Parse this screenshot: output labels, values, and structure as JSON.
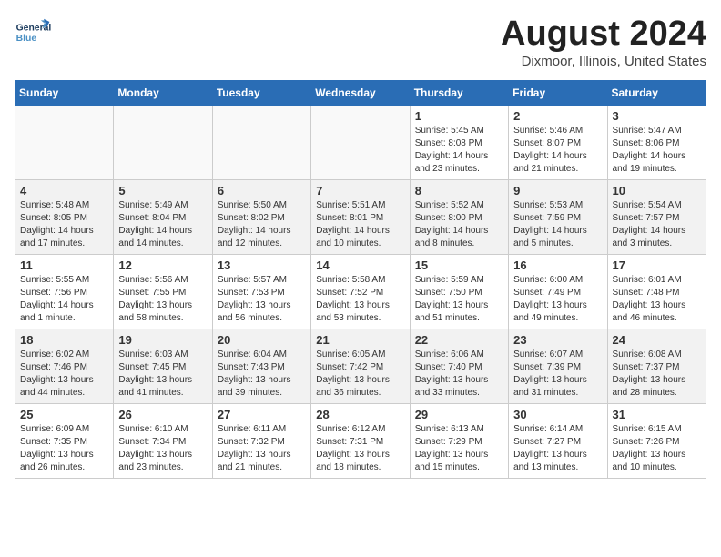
{
  "header": {
    "logo_general": "General",
    "logo_blue": "Blue",
    "title": "August 2024",
    "subtitle": "Dixmoor, Illinois, United States"
  },
  "days_of_week": [
    "Sunday",
    "Monday",
    "Tuesday",
    "Wednesday",
    "Thursday",
    "Friday",
    "Saturday"
  ],
  "weeks": [
    [
      {
        "day": "",
        "info": ""
      },
      {
        "day": "",
        "info": ""
      },
      {
        "day": "",
        "info": ""
      },
      {
        "day": "",
        "info": ""
      },
      {
        "day": "1",
        "info": "Sunrise: 5:45 AM\nSunset: 8:08 PM\nDaylight: 14 hours\nand 23 minutes."
      },
      {
        "day": "2",
        "info": "Sunrise: 5:46 AM\nSunset: 8:07 PM\nDaylight: 14 hours\nand 21 minutes."
      },
      {
        "day": "3",
        "info": "Sunrise: 5:47 AM\nSunset: 8:06 PM\nDaylight: 14 hours\nand 19 minutes."
      }
    ],
    [
      {
        "day": "4",
        "info": "Sunrise: 5:48 AM\nSunset: 8:05 PM\nDaylight: 14 hours\nand 17 minutes."
      },
      {
        "day": "5",
        "info": "Sunrise: 5:49 AM\nSunset: 8:04 PM\nDaylight: 14 hours\nand 14 minutes."
      },
      {
        "day": "6",
        "info": "Sunrise: 5:50 AM\nSunset: 8:02 PM\nDaylight: 14 hours\nand 12 minutes."
      },
      {
        "day": "7",
        "info": "Sunrise: 5:51 AM\nSunset: 8:01 PM\nDaylight: 14 hours\nand 10 minutes."
      },
      {
        "day": "8",
        "info": "Sunrise: 5:52 AM\nSunset: 8:00 PM\nDaylight: 14 hours\nand 8 minutes."
      },
      {
        "day": "9",
        "info": "Sunrise: 5:53 AM\nSunset: 7:59 PM\nDaylight: 14 hours\nand 5 minutes."
      },
      {
        "day": "10",
        "info": "Sunrise: 5:54 AM\nSunset: 7:57 PM\nDaylight: 14 hours\nand 3 minutes."
      }
    ],
    [
      {
        "day": "11",
        "info": "Sunrise: 5:55 AM\nSunset: 7:56 PM\nDaylight: 14 hours\nand 1 minute."
      },
      {
        "day": "12",
        "info": "Sunrise: 5:56 AM\nSunset: 7:55 PM\nDaylight: 13 hours\nand 58 minutes."
      },
      {
        "day": "13",
        "info": "Sunrise: 5:57 AM\nSunset: 7:53 PM\nDaylight: 13 hours\nand 56 minutes."
      },
      {
        "day": "14",
        "info": "Sunrise: 5:58 AM\nSunset: 7:52 PM\nDaylight: 13 hours\nand 53 minutes."
      },
      {
        "day": "15",
        "info": "Sunrise: 5:59 AM\nSunset: 7:50 PM\nDaylight: 13 hours\nand 51 minutes."
      },
      {
        "day": "16",
        "info": "Sunrise: 6:00 AM\nSunset: 7:49 PM\nDaylight: 13 hours\nand 49 minutes."
      },
      {
        "day": "17",
        "info": "Sunrise: 6:01 AM\nSunset: 7:48 PM\nDaylight: 13 hours\nand 46 minutes."
      }
    ],
    [
      {
        "day": "18",
        "info": "Sunrise: 6:02 AM\nSunset: 7:46 PM\nDaylight: 13 hours\nand 44 minutes."
      },
      {
        "day": "19",
        "info": "Sunrise: 6:03 AM\nSunset: 7:45 PM\nDaylight: 13 hours\nand 41 minutes."
      },
      {
        "day": "20",
        "info": "Sunrise: 6:04 AM\nSunset: 7:43 PM\nDaylight: 13 hours\nand 39 minutes."
      },
      {
        "day": "21",
        "info": "Sunrise: 6:05 AM\nSunset: 7:42 PM\nDaylight: 13 hours\nand 36 minutes."
      },
      {
        "day": "22",
        "info": "Sunrise: 6:06 AM\nSunset: 7:40 PM\nDaylight: 13 hours\nand 33 minutes."
      },
      {
        "day": "23",
        "info": "Sunrise: 6:07 AM\nSunset: 7:39 PM\nDaylight: 13 hours\nand 31 minutes."
      },
      {
        "day": "24",
        "info": "Sunrise: 6:08 AM\nSunset: 7:37 PM\nDaylight: 13 hours\nand 28 minutes."
      }
    ],
    [
      {
        "day": "25",
        "info": "Sunrise: 6:09 AM\nSunset: 7:35 PM\nDaylight: 13 hours\nand 26 minutes."
      },
      {
        "day": "26",
        "info": "Sunrise: 6:10 AM\nSunset: 7:34 PM\nDaylight: 13 hours\nand 23 minutes."
      },
      {
        "day": "27",
        "info": "Sunrise: 6:11 AM\nSunset: 7:32 PM\nDaylight: 13 hours\nand 21 minutes."
      },
      {
        "day": "28",
        "info": "Sunrise: 6:12 AM\nSunset: 7:31 PM\nDaylight: 13 hours\nand 18 minutes."
      },
      {
        "day": "29",
        "info": "Sunrise: 6:13 AM\nSunset: 7:29 PM\nDaylight: 13 hours\nand 15 minutes."
      },
      {
        "day": "30",
        "info": "Sunrise: 6:14 AM\nSunset: 7:27 PM\nDaylight: 13 hours\nand 13 minutes."
      },
      {
        "day": "31",
        "info": "Sunrise: 6:15 AM\nSunset: 7:26 PM\nDaylight: 13 hours\nand 10 minutes."
      }
    ]
  ]
}
